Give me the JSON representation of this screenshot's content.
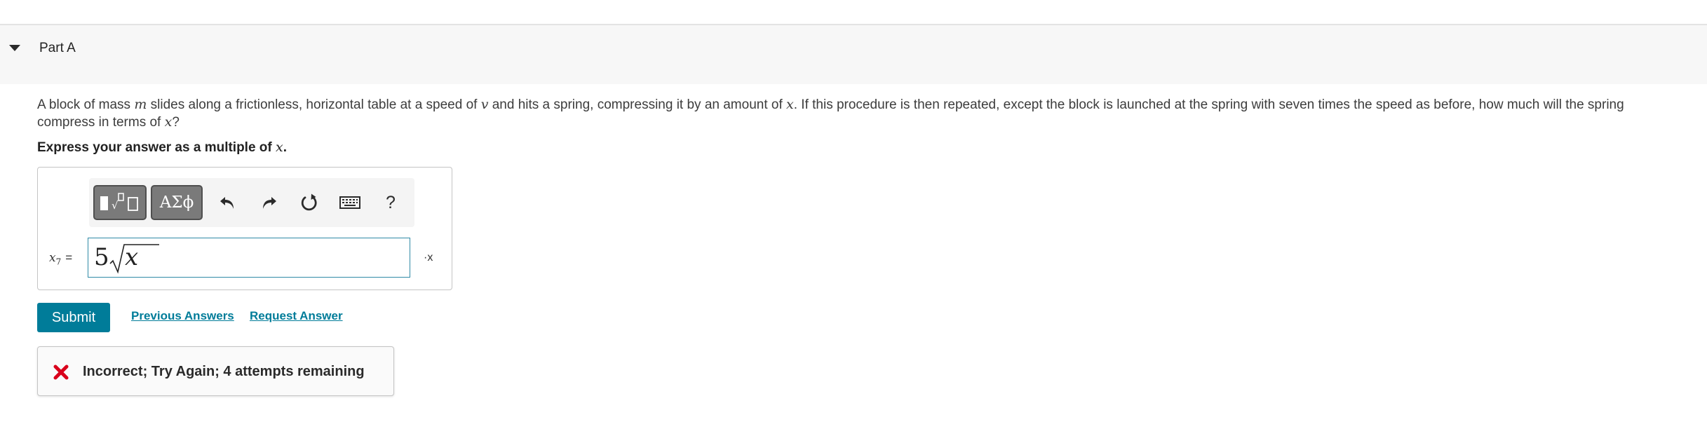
{
  "part": {
    "title": "Part A"
  },
  "problem": {
    "seg1": "A block of mass ",
    "var_m": "m",
    "seg2": " slides along a frictionless, horizontal table at a speed of ",
    "var_v": "v",
    "seg3": " and hits a spring, compressing it by an amount of ",
    "var_x1": "x",
    "seg4": ". If this procedure is then repeated, except the block is launched at the spring with seven times the speed as before, how much will the spring compress in terms of ",
    "var_x2": "x",
    "seg5": "?"
  },
  "instruction": {
    "text": "Express your answer as a multiple of ",
    "var": "x",
    "end": "."
  },
  "toolbar": {
    "greek_label": "ΑΣϕ",
    "help_label": "?",
    "icons": [
      "templates-icon",
      "greek-letters-icon",
      "undo-icon",
      "redo-icon",
      "reset-icon",
      "keyboard-icon",
      "help-icon"
    ]
  },
  "answer": {
    "label_var": "x",
    "label_sub": "7",
    "label_eq": "=",
    "coefficient": "5",
    "radicand": "x",
    "units": "·x"
  },
  "actions": {
    "submit_label": "Submit",
    "previous_answers_label": "Previous Answers",
    "request_answer_label": "Request Answer"
  },
  "feedback": {
    "text": "Incorrect; Try Again; 4 attempts remaining"
  },
  "colors": {
    "accent": "#007c99",
    "input_border": "#2f8aa6",
    "error": "#d9001b",
    "header_bg": "#f7f7f7"
  }
}
